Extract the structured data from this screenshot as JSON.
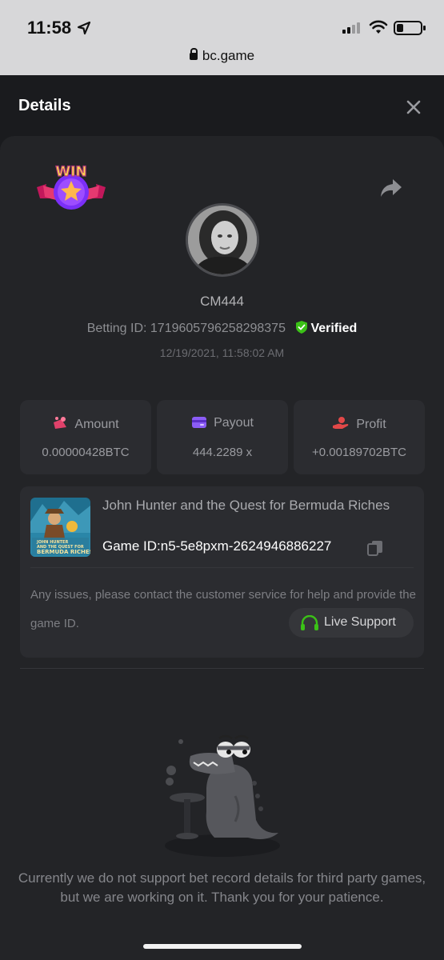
{
  "status_bar": {
    "time": "11:58",
    "url": "bc.game"
  },
  "header": {
    "title": "Details"
  },
  "bet": {
    "username": "CM444",
    "betting_id_label": "Betting ID:",
    "betting_id": "1719605796258298375",
    "verified_label": "Verified",
    "datetime": "12/19/2021, 11:58:02 AM",
    "badge_text": "WIN"
  },
  "stats": [
    {
      "label": "Amount",
      "value": "0.00000428BTC",
      "icon": "coins-icon",
      "color": "#e0416a"
    },
    {
      "label": "Payout",
      "value": "444.2289 x",
      "icon": "wallet-card-icon",
      "color": "#8b5cf6"
    },
    {
      "label": "Profit",
      "value": "+0.00189702BTC",
      "icon": "hand-coin-icon",
      "color": "#e24848"
    }
  ],
  "game": {
    "name": "John Hunter and the Quest for Bermuda Riches",
    "id_label": "Game ID:",
    "id": "n5-5e8pxm-2624946886227",
    "thumb_text_1": "JOHN HUNTER",
    "thumb_text_2": "AND THE QUEST FOR",
    "thumb_text_3": "BERMUDA RICHES",
    "issue_text": "Any issues, please contact the customer service for help and provide the game ID.",
    "live_support_label": "Live Support"
  },
  "notice": "Currently we do not support bet record details for third party games, but we are working on it. Thank you for your patience.",
  "colors": {
    "verified": "#3bc117",
    "accent_green": "#3bc117",
    "panel": "#232427",
    "card": "#2b2c30"
  }
}
